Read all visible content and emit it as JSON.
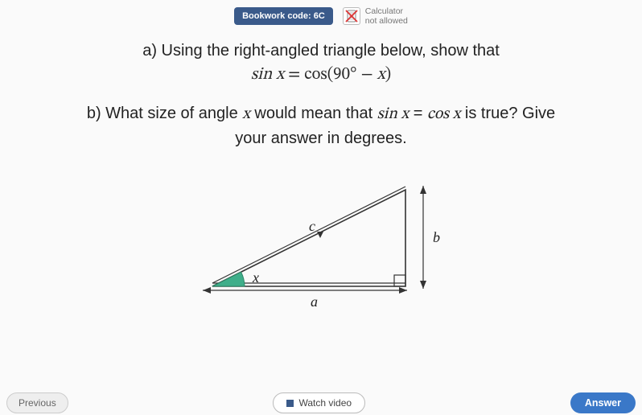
{
  "header": {
    "bookwork_label": "Bookwork code: 6C",
    "calc_line1": "Calculator",
    "calc_line2": "not allowed"
  },
  "question": {
    "part_a_intro": "a) Using the right-angled triangle below, show that",
    "equation_lhs": "sin x",
    "equation_eq": " = ",
    "equation_rhs": "cos(90° − x)",
    "part_b_line1": "b) What size of angle x would mean that sin x = cos x is true? Give",
    "part_b_line2": "your answer in degrees."
  },
  "figure": {
    "label_hypotenuse": "c",
    "label_opposite": "b",
    "label_adjacent": "a",
    "label_angle": "x"
  },
  "footer": {
    "previous": "Previous",
    "watch_video": "Watch video",
    "answer": "Answer"
  }
}
